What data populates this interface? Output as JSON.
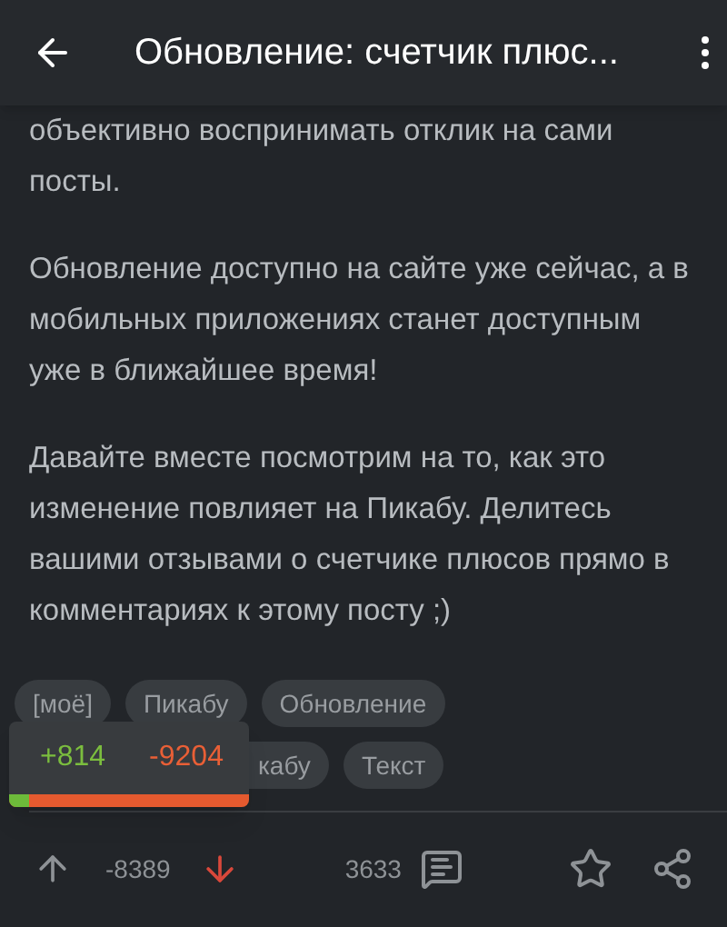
{
  "header": {
    "title": "Обновление: счетчик плюс..."
  },
  "paragraphs": [
    "объективно воспринимать отклик на сами посты.",
    "Обновление доступно на сайте уже сейчас, а в мобильных приложениях станет доступным уже в ближайшее время!",
    "Давайте вместе посмотрим на то, как это изменение повлияет на Пикабу. Делитесь вашими отзывами о счетчике плюсов прямо в комментариях к этому посту ;)"
  ],
  "tag_rows": [
    [
      "[моё]",
      "Пикабу",
      "Обновление"
    ],
    [
      "кабу",
      "Текст"
    ]
  ],
  "vote_popup": {
    "pluses": "+814",
    "minuses": "-9204",
    "level": 0.08
  },
  "footer": {
    "rating": "-8389",
    "upvoted": false,
    "downvoted": true,
    "comments": "3633",
    "saved": false
  }
}
